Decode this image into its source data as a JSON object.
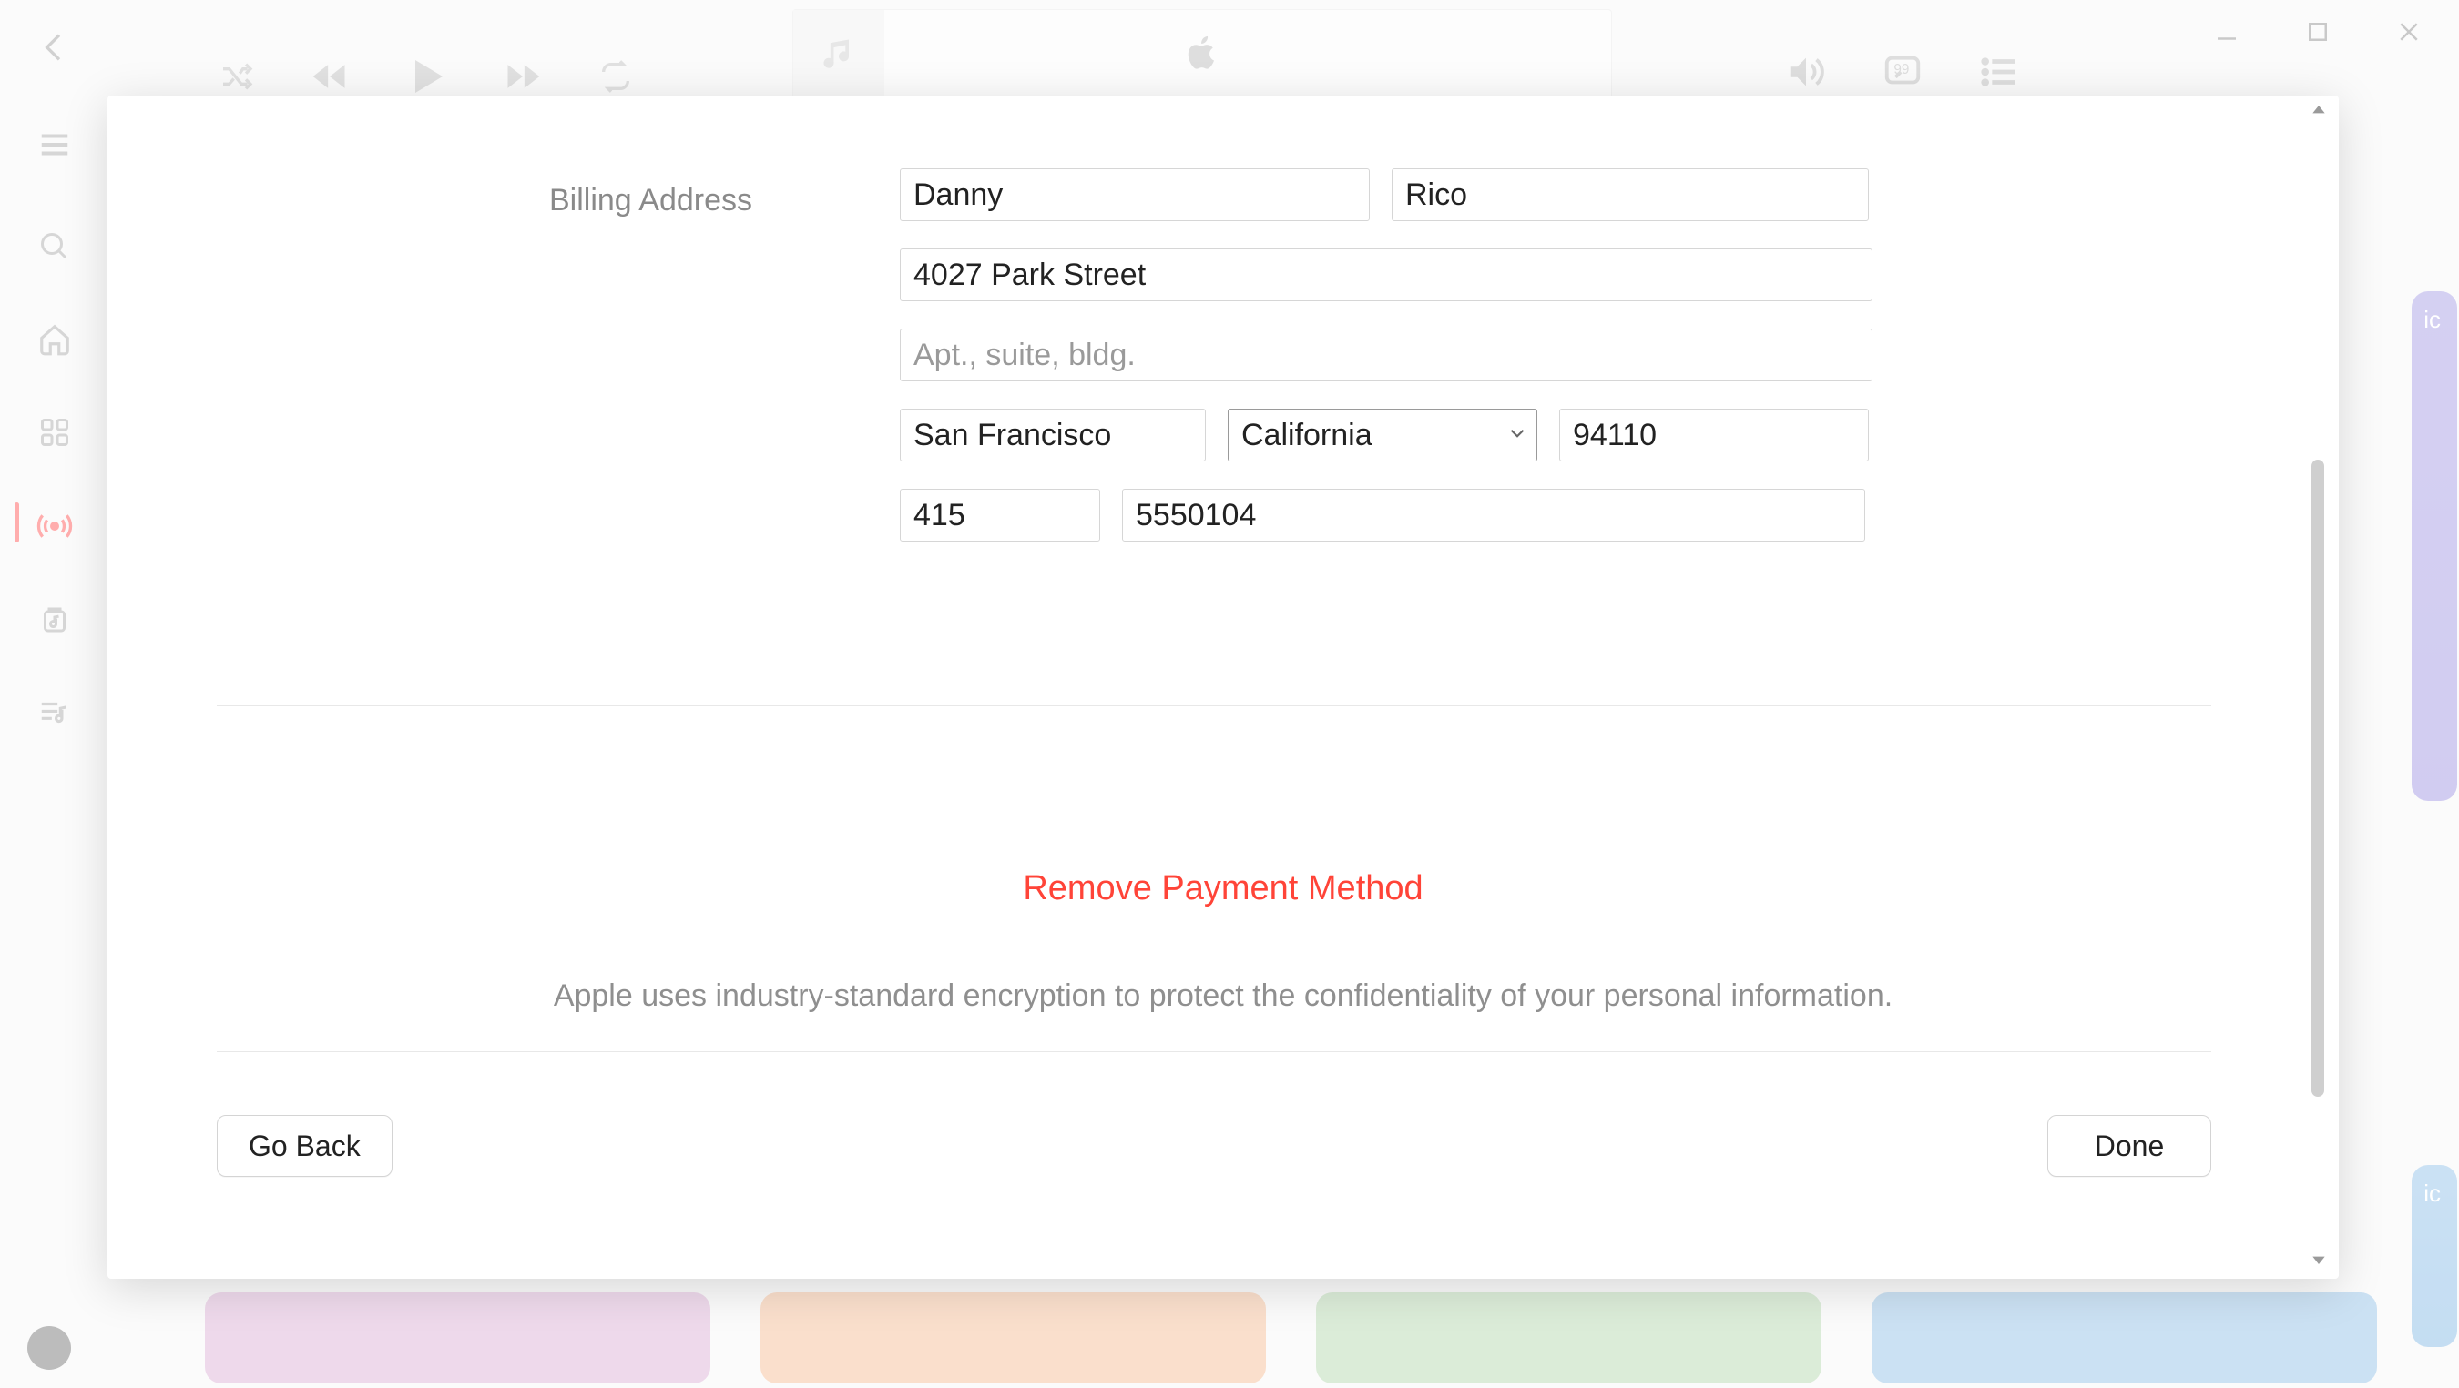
{
  "background_card_label": "ic",
  "billing": {
    "section_label": "Billing Address",
    "first_name": "Danny",
    "last_name": "Rico",
    "address1": "4027 Park Street",
    "address2_placeholder": "Apt., suite, bldg.",
    "city": "San Francisco",
    "state": "California",
    "zip": "94110",
    "phone_area": "415",
    "phone_number": "5550104"
  },
  "actions": {
    "remove_payment": "Remove Payment Method",
    "encryption_note": "Apple uses industry-standard encryption to protect the confidentiality of your personal information.",
    "go_back": "Go Back",
    "done": "Done"
  }
}
